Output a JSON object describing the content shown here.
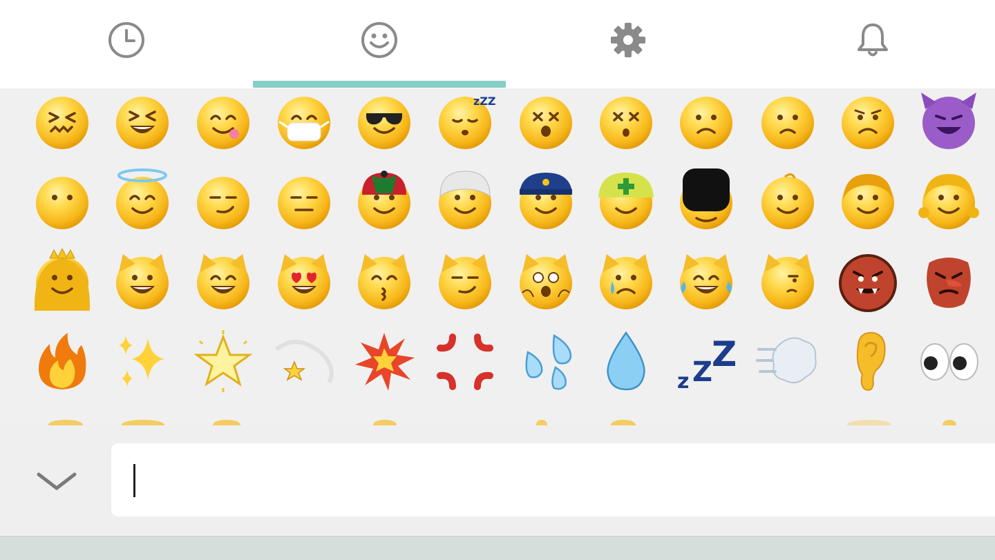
{
  "tabs": [
    {
      "id": "recent",
      "icon": "clock-icon"
    },
    {
      "id": "emoji",
      "icon": "smiley-icon",
      "selected": true
    },
    {
      "id": "settings",
      "icon": "gear-icon"
    },
    {
      "id": "notifications",
      "icon": "bell-icon"
    }
  ],
  "colors": {
    "tab_indicator": "#86cfc7",
    "tab_icon": "#8a8a8a",
    "grid_background": "#f0f0f0",
    "input_background": "#ffffff"
  },
  "emoji_grid": {
    "rows": [
      [
        "confounded-face-icon",
        "grinning-squinting-face-icon",
        "face-savoring-food-icon",
        "face-with-medical-mask-icon",
        "smiling-face-with-sunglasses-icon",
        "sleeping-face-icon",
        "dizzy-face-icon",
        "astonished-dizzy-face-icon",
        "frowning-face-icon",
        "anguished-face-icon",
        "worried-face-icon",
        "smiling-imp-icon"
      ],
      [
        "face-without-mouth-icon",
        "smiling-face-with-halo-icon",
        "smirking-face-icon",
        "expressionless-face-icon",
        "man-with-gua-pi-mao-icon",
        "man-with-turban-icon",
        "police-officer-icon",
        "construction-worker-icon",
        "guardsman-icon",
        "baby-icon",
        "boy-icon",
        "girl-icon"
      ],
      [
        "princess-icon",
        "grinning-cat-icon",
        "grinning-cat-smiling-eyes-icon",
        "smiling-cat-heart-eyes-icon",
        "kissing-cat-icon",
        "wry-smile-cat-icon",
        "weary-cat-icon",
        "crying-cat-icon",
        "cat-tears-of-joy-icon",
        "pouting-cat-icon",
        "ogre-icon",
        "goblin-icon"
      ],
      [
        "fire-icon",
        "sparkles-icon",
        "glowing-star-icon",
        "dizzy-symbol-icon",
        "collision-icon",
        "anger-symbol-icon",
        "sweat-droplets-icon",
        "droplet-icon",
        "zzz-icon",
        "dashing-away-icon",
        "ear-icon",
        "eyes-icon"
      ]
    ]
  },
  "input": {
    "value": "",
    "placeholder": ""
  },
  "collapse_button_icon": "chevron-down-icon"
}
